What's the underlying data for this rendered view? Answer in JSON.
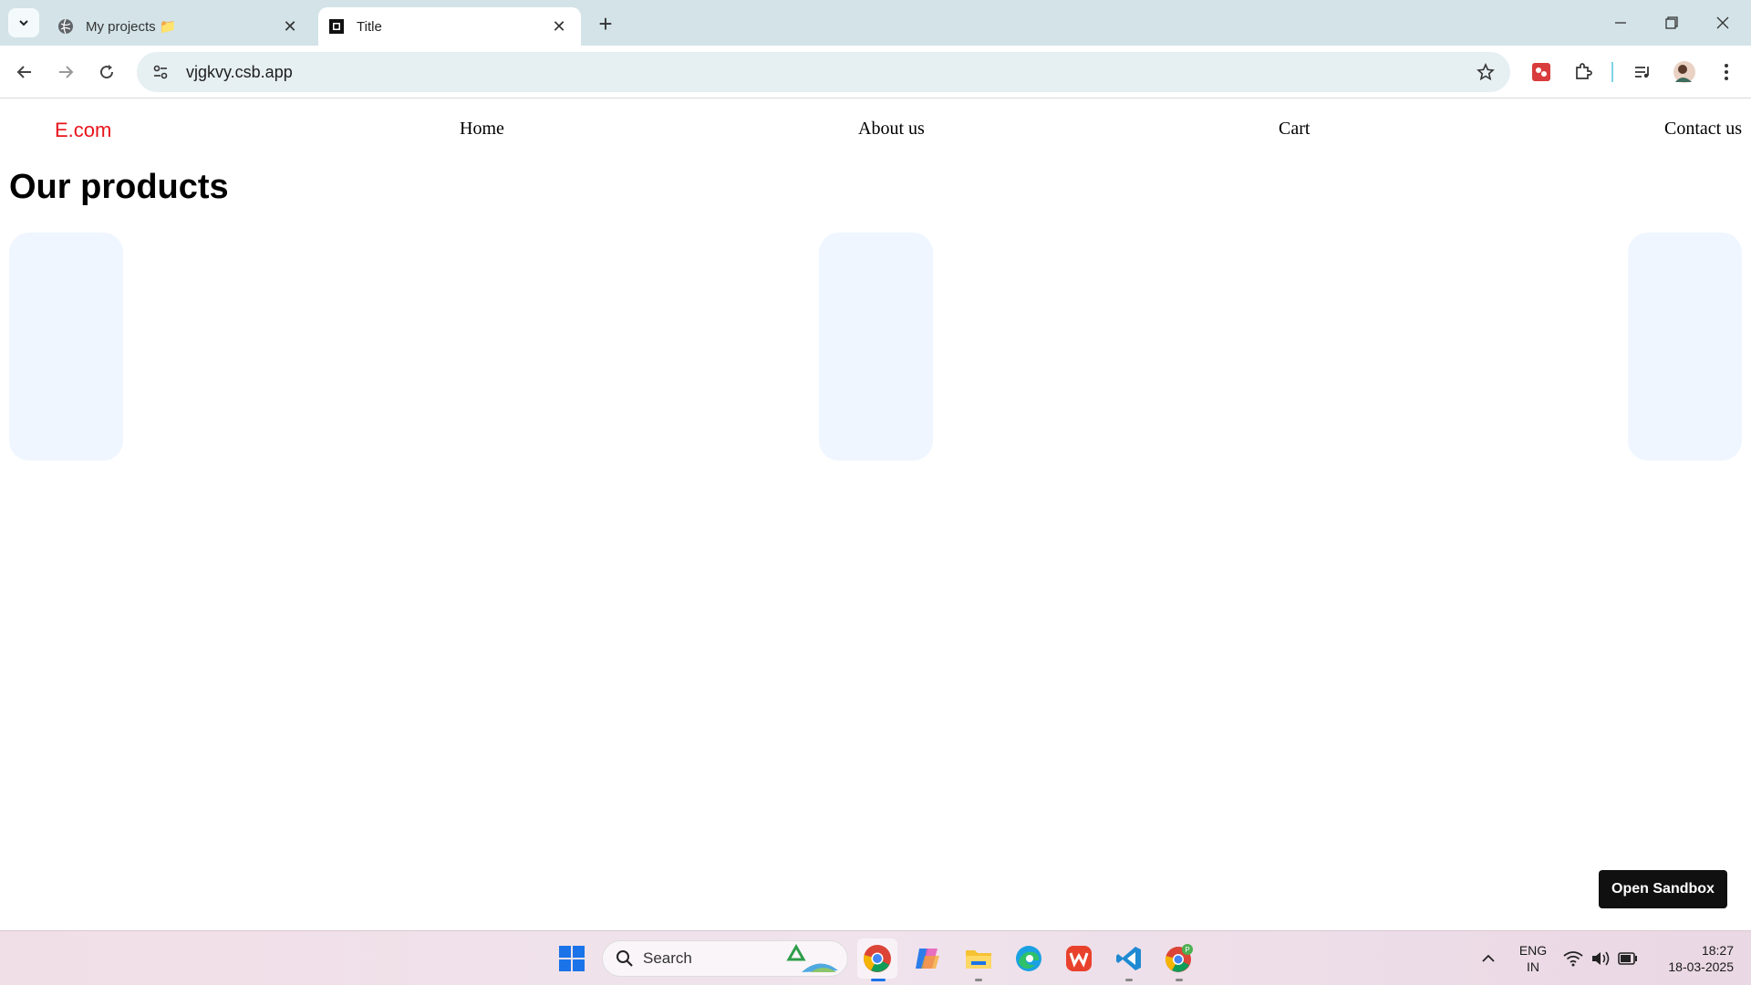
{
  "browser": {
    "tabs": [
      {
        "title": "My projects 📁",
        "active": false
      },
      {
        "title": "Title",
        "active": true
      }
    ],
    "url": "vjgkvy.csb.app"
  },
  "site": {
    "logo": "E.com",
    "nav": [
      "Home",
      "About us",
      "Cart",
      "Contact us"
    ],
    "heading": "Our products",
    "open_sandbox_label": "Open Sandbox",
    "card_color": "#eff6ff",
    "logo_color": "#e8141b"
  },
  "taskbar": {
    "search_label": "Search",
    "lang_line1": "ENG",
    "lang_line2": "IN",
    "time": "18:27",
    "date": "18-03-2025",
    "apps": [
      "chrome-icon",
      "copilot-icon",
      "file-explorer-icon",
      "edge-icon",
      "wps-office-icon",
      "vscode-icon",
      "chrome-profile-icon"
    ]
  }
}
